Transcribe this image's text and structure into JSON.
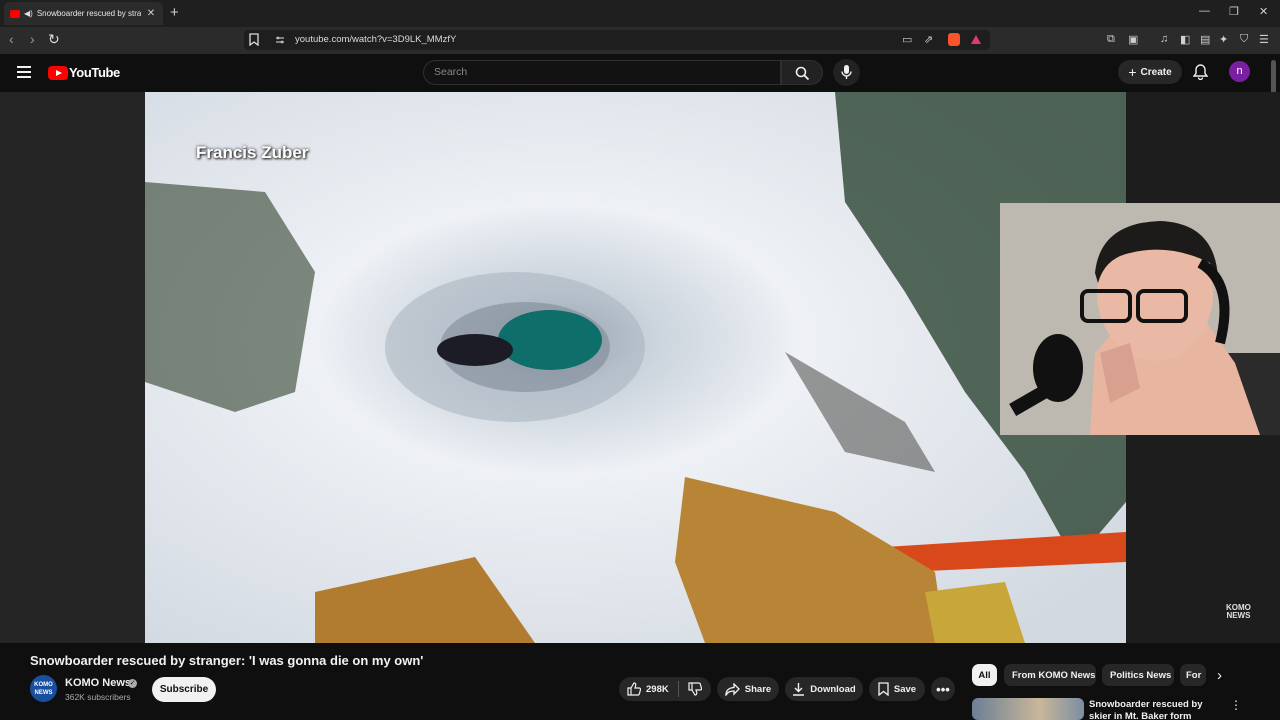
{
  "browser": {
    "tab_title": "Snowboarder rescued by stra",
    "url": "youtube.com/watch?v=3D9LK_MMzfY"
  },
  "header": {
    "logo_text": "YouTube",
    "search_placeholder": "Search",
    "create_label": "Create",
    "avatar_letter": "n"
  },
  "video": {
    "caption": "Francis Zuber",
    "watermark_line1": "KOMO",
    "watermark_line2": "NEWS"
  },
  "details": {
    "title": "Snowboarder rescued by stranger: 'I was gonna die on my own'",
    "channel_name": "KOMO News",
    "channel_avatar_text": "KOMO NEWS",
    "subscribers": "362K subscribers",
    "subscribe_label": "Subscribe",
    "likes": "298K",
    "share_label": "Share",
    "download_label": "Download",
    "save_label": "Save"
  },
  "chips": [
    "All",
    "From KOMO News",
    "Politics News",
    "For"
  ],
  "recommendation": {
    "title": "Snowboarder rescued by skier in Mt. Baker form lifelong bon"
  },
  "colors": {
    "brand_red": "#ff0000",
    "background": "#0f0f0f",
    "pill_bg": "#272727"
  }
}
